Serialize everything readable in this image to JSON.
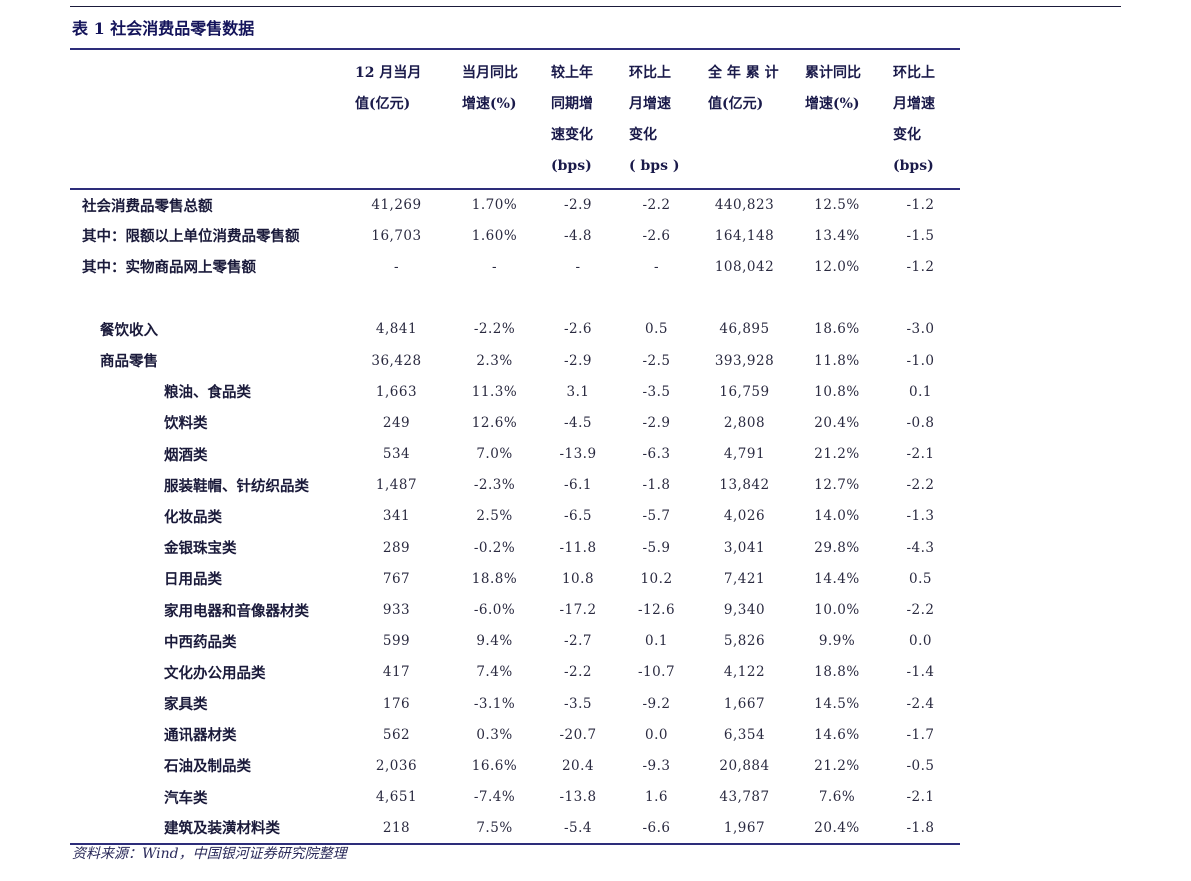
{
  "title": "表 1 社会消费品零售数据",
  "header": {
    "columns": [
      {
        "lines": [
          "12 月当月",
          "值(亿元)"
        ]
      },
      {
        "lines": [
          "当月同比",
          "增速(%)"
        ]
      },
      {
        "lines": [
          "较上年",
          "同期增",
          "速变化",
          "(bps)"
        ]
      },
      {
        "lines": [
          "环比上",
          "月增速",
          "变化",
          "( bps )"
        ]
      },
      {
        "lines": [
          "全 年 累 计",
          "值(亿元)"
        ]
      },
      {
        "lines": [
          "累计同比",
          "增速(%)"
        ]
      },
      {
        "lines": [
          "环比上",
          "月增速",
          "变化",
          "(bps)"
        ]
      }
    ]
  },
  "rows": [
    {
      "name": "社会消费品零售总额",
      "level": 0,
      "values": [
        "41,269",
        "1.70%",
        "-2.9",
        "-2.2",
        "440,823",
        "12.5%",
        "-1.2"
      ]
    },
    {
      "name": "其中：限额以上单位消费品零售额",
      "level": 0,
      "values": [
        "16,703",
        "1.60%",
        "-4.8",
        "-2.6",
        "164,148",
        "13.4%",
        "-1.5"
      ]
    },
    {
      "name": "其中：实物商品网上零售额",
      "level": 0,
      "values": [
        "-",
        "-",
        "-",
        "-",
        "108,042",
        "12.0%",
        "-1.2"
      ]
    },
    {
      "spacer": true
    },
    {
      "name": "餐饮收入",
      "level": 1,
      "values": [
        "4,841",
        "-2.2%",
        "-2.6",
        "0.5",
        "46,895",
        "18.6%",
        "-3.0"
      ]
    },
    {
      "name": "商品零售",
      "level": 1,
      "values": [
        "36,428",
        "2.3%",
        "-2.9",
        "-2.5",
        "393,928",
        "11.8%",
        "-1.0"
      ]
    },
    {
      "name": "粮油、食品类",
      "level": 2,
      "values": [
        "1,663",
        "11.3%",
        "3.1",
        "-3.5",
        "16,759",
        "10.8%",
        "0.1"
      ]
    },
    {
      "name": "饮料类",
      "level": 2,
      "values": [
        "249",
        "12.6%",
        "-4.5",
        "-2.9",
        "2,808",
        "20.4%",
        "-0.8"
      ]
    },
    {
      "name": "烟酒类",
      "level": 2,
      "values": [
        "534",
        "7.0%",
        "-13.9",
        "-6.3",
        "4,791",
        "21.2%",
        "-2.1"
      ]
    },
    {
      "name": "服装鞋帽、针纺织品类",
      "level": 2,
      "values": [
        "1,487",
        "-2.3%",
        "-6.1",
        "-1.8",
        "13,842",
        "12.7%",
        "-2.2"
      ]
    },
    {
      "name": "化妆品类",
      "level": 2,
      "values": [
        "341",
        "2.5%",
        "-6.5",
        "-5.7",
        "4,026",
        "14.0%",
        "-1.3"
      ]
    },
    {
      "name": "金银珠宝类",
      "level": 2,
      "values": [
        "289",
        "-0.2%",
        "-11.8",
        "-5.9",
        "3,041",
        "29.8%",
        "-4.3"
      ]
    },
    {
      "name": "日用品类",
      "level": 2,
      "values": [
        "767",
        "18.8%",
        "10.8",
        "10.2",
        "7,421",
        "14.4%",
        "0.5"
      ]
    },
    {
      "name": "家用电器和音像器材类",
      "level": 2,
      "values": [
        "933",
        "-6.0%",
        "-17.2",
        "-12.6",
        "9,340",
        "10.0%",
        "-2.2"
      ]
    },
    {
      "name": "中西药品类",
      "level": 2,
      "values": [
        "599",
        "9.4%",
        "-2.7",
        "0.1",
        "5,826",
        "9.9%",
        "0.0"
      ]
    },
    {
      "name": "文化办公用品类",
      "level": 2,
      "values": [
        "417",
        "7.4%",
        "-2.2",
        "-10.7",
        "4,122",
        "18.8%",
        "-1.4"
      ]
    },
    {
      "name": "家具类",
      "level": 2,
      "values": [
        "176",
        "-3.1%",
        "-3.5",
        "-9.2",
        "1,667",
        "14.5%",
        "-2.4"
      ]
    },
    {
      "name": "通讯器材类",
      "level": 2,
      "values": [
        "562",
        "0.3%",
        "-20.7",
        "0.0",
        "6,354",
        "14.6%",
        "-1.7"
      ]
    },
    {
      "name": "石油及制品类",
      "level": 2,
      "values": [
        "2,036",
        "16.6%",
        "20.4",
        "-9.3",
        "20,884",
        "21.2%",
        "-0.5"
      ]
    },
    {
      "name": "汽车类",
      "level": 2,
      "values": [
        "4,651",
        "-7.4%",
        "-13.8",
        "1.6",
        "43,787",
        "7.6%",
        "-2.1"
      ]
    },
    {
      "name": "建筑及装潢材料类",
      "level": 2,
      "values": [
        "218",
        "7.5%",
        "-5.4",
        "-6.6",
        "1,967",
        "20.4%",
        "-1.8"
      ]
    }
  ],
  "source": "资料来源：Wind，中国银河证券研究院整理"
}
